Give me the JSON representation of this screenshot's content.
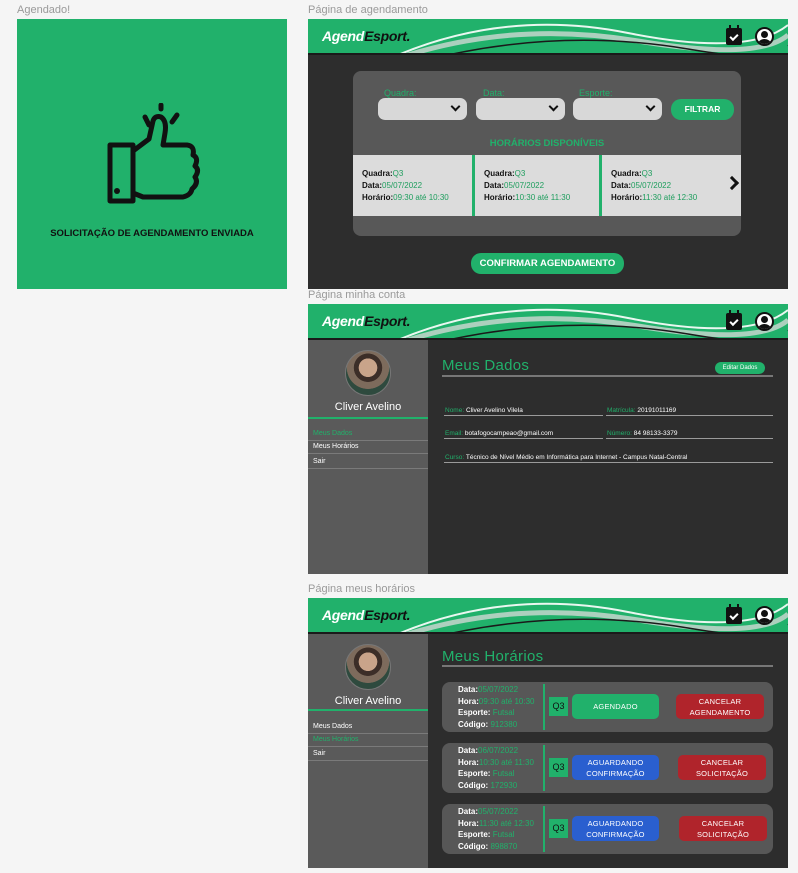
{
  "frames": {
    "success_label": "Agendado!",
    "agenda_label": "Página de agendamento",
    "conta_label": "Página minha conta",
    "horarios_label": "Página meus horários"
  },
  "colors": {
    "brand": "#21b16b",
    "dark": "#2d2d2d",
    "blue": "#2a5fcf",
    "red": "#b0242b"
  },
  "success": {
    "message": "SOLICITAÇÃO DE AGENDAMENTO ENVIADA",
    "icon": "thumbs-up-icon"
  },
  "header": {
    "logo_a": "Agend",
    "logo_b": "Esport."
  },
  "agenda": {
    "filters": {
      "quadra": "Quadra:",
      "data": "Data:",
      "esporte": "Esporte:"
    },
    "filter_button": "FILTRAR",
    "section_title": "HORÁRIOS DISPONÍVEIS",
    "slots": [
      {
        "quadra_k": "Quadra:",
        "quadra_v": "Q3",
        "data_k": "Data:",
        "data_v": "05/07/2022",
        "hora_k": "Horário:",
        "hora_v": "09:30 até 10:30"
      },
      {
        "quadra_k": "Quadra:",
        "quadra_v": "Q3",
        "data_k": "Data:",
        "data_v": "05/07/2022",
        "hora_k": "Horário:",
        "hora_v": "10:30 até 11:30"
      },
      {
        "quadra_k": "Quadra:",
        "quadra_v": "Q3",
        "data_k": "Data:",
        "data_v": "05/07/2022",
        "hora_k": "Horário:",
        "hora_v": "11:30 até 12:30"
      }
    ],
    "confirm_button": "CONFIRMAR AGENDAMENTO"
  },
  "user": {
    "name": "Cliver Avelino"
  },
  "sidebar": {
    "items": [
      "Meus Dados",
      "Meus Horários",
      "Sair"
    ]
  },
  "conta": {
    "title": "Meus Dados",
    "edit_button": "Editar Dados",
    "nome_k": "Nome:",
    "nome_v": "Cliver Avelino Vilela",
    "matricula_k": "Matrícula:",
    "matricula_v": "20191011169",
    "email_k": "Email:",
    "email_v": "botafogocampeao@gmail.com",
    "numero_k": "Número:",
    "numero_v": "84 98133-3379",
    "curso_k": "Curso:",
    "curso_v": "Técnico de Nível Médio em Informática para Internet - Campus Natal-Central"
  },
  "horarios": {
    "title": "Meus Horários",
    "cards": [
      {
        "data": "05/07/2022",
        "hora": "09:30 até 10:30",
        "esporte": "Futsal",
        "codigo": "912380",
        "quadra": "Q3",
        "status": "AGENDADO",
        "cancel": "CANCELAR AGENDAMENTO"
      },
      {
        "data": "06/07/2022",
        "hora": "10:30 até 11:30",
        "esporte": "Futsal",
        "codigo": "172930",
        "quadra": "Q3",
        "status": "AGUARDANDO CONFIRMAÇÃO",
        "cancel": "CANCELAR SOLICITAÇÃO"
      },
      {
        "data": "05/07/2022",
        "hora": "11:30 até 12:30",
        "esporte": "Futsal",
        "codigo": "898870",
        "quadra": "Q3",
        "status": "AGUARDANDO CONFIRMAÇÃO",
        "cancel": "CANCELAR SOLICITAÇÃO"
      }
    ],
    "labels": {
      "data": "Data:",
      "hora": "Hora:",
      "esporte": "Esporte:",
      "codigo": "Código:"
    }
  }
}
